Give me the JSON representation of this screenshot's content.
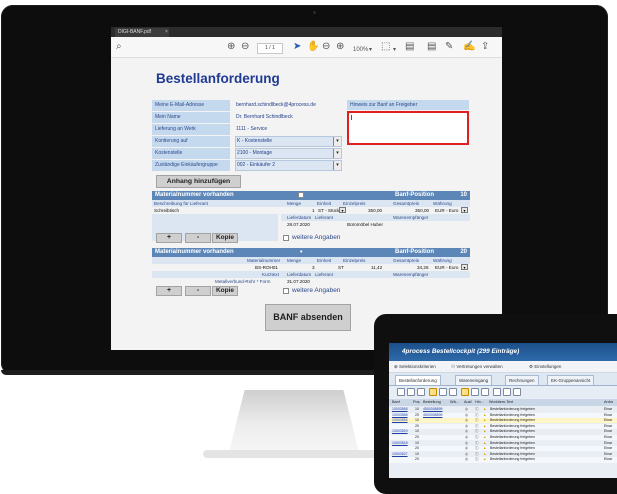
{
  "tab": {
    "title": "DIGI-BANF.pdf",
    "close": "×"
  },
  "toolbar": {
    "search_icon": "⌕",
    "up_icon": "⊕",
    "down_icon": "⊖",
    "page": "1",
    "page_total": "/ 1",
    "cursor_icon": "➤",
    "hand_icon": "✋",
    "zoom_out_icon": "⊖",
    "zoom_in_icon": "⊕",
    "zoom": "100%",
    "zoom_caret": "▾",
    "fit_icon": "⬚",
    "fit_caret": "▾",
    "comment_icon": "▤",
    "draw_icon": "✎",
    "sign_icon": "✍",
    "share_icon": "⇪"
  },
  "form": {
    "title": "Bestellanforderung",
    "fields": [
      {
        "label": "Meine E-Mail-Adresse",
        "value": "bernhard.schindlbeck@4process.de"
      },
      {
        "label": "Mein Name",
        "value": "Dr. Bernhard Schindlbeck"
      },
      {
        "label": "Lieferung an Werk",
        "value": "1111 - Service"
      },
      {
        "label": "Kontierung auf",
        "value": "K - Kostenstelle"
      },
      {
        "label": "Kostenstelle",
        "value": "2100 - Montage"
      },
      {
        "label": "Zuständige Einkäufergruppe",
        "value": "002 - Einkäufer 2"
      }
    ],
    "hint_label": "Hinweis zur Banf an Freigeber",
    "attach_button": "Anhang hinzufügen",
    "submit_button": "BANF absenden"
  },
  "position1": {
    "header_left": "Materialnummer vorhanden",
    "header_right": "Banf-Position",
    "number": "10",
    "cols": {
      "desc": "Beschreibung für Lieferant",
      "qty": "Menge",
      "unit": "Einheit",
      "price": "Einzelpreis",
      "total": "Gesamtpreis",
      "currency": "Währung"
    },
    "desc_value": "Schreibtisch",
    "qty": "1",
    "unit": "ST - Stück",
    "price": "350,00",
    "total": "350,00",
    "currency": "EUR - Euro",
    "delivery_label": "Lieferdatum",
    "supplier_label": "Lieferant",
    "recipient_label": "Warenempfänger",
    "delivery_date": "28.07.2020",
    "supplier": "Büromöbel Huber",
    "btn_plus": "+",
    "btn_minus": "-",
    "btn_copy": "Kopie",
    "more": "weitere Angaben"
  },
  "position2": {
    "header_left": "Materialnummer vorhanden",
    "header_right": "Banf-Position",
    "number": "20",
    "cols": {
      "mat": "Materialnummer",
      "qty": "Menge",
      "unit": "Einheit",
      "price": "Einzelpreis",
      "total": "Gesamtpreis",
      "currency": "Währung"
    },
    "material": "BS-ROH01",
    "qty": "3",
    "unit": "ST",
    "price": "11,42",
    "total": "34,26",
    "currency": "EUR - Euro",
    "short_label": "Kurztext",
    "delivery_label": "Lieferdatum",
    "supplier_label": "Lieferant",
    "recipient_label": "Warenempfänger",
    "short_text": "Metallverbund-Rohr * Form",
    "delivery_date": "31.07.2020",
    "btn_plus": "+",
    "btn_minus": "-",
    "btn_copy": "Kopie",
    "more": "weitere Angaben"
  },
  "cockpit": {
    "title": "4process Bestellcockpit (299 Einträge)",
    "toolbar": [
      "Selektionskriterien",
      "Vertretungen verwalten",
      "Einstellungen"
    ],
    "tabs": [
      "Bestellanforderung",
      "Wareneingang",
      "Rechnungen",
      "EK-Gruppenansicht"
    ],
    "headers": [
      "Banf",
      "Pos.",
      "Bestellung",
      "Wä...",
      "Ausf",
      "Hin...",
      "Workitem-Text",
      "Anfor"
    ],
    "rows": [
      {
        "banf": "10003558",
        "pos": "10",
        "order": "4500008899",
        "text": "Bestellanforderung freigeben",
        "req": "Einar"
      },
      {
        "banf": "10003558",
        "pos": "20",
        "order": "4500008899",
        "text": "Bestellanforderung freigeben",
        "req": "Einar"
      },
      {
        "banf": "10003554",
        "pos": "10",
        "order": "",
        "text": "Bestellanforderung freigeben",
        "req": "Einar"
      },
      {
        "banf": "",
        "pos": "20",
        "order": "",
        "text": "Bestellanforderung freigeben",
        "req": "Einar"
      },
      {
        "banf": "10003529",
        "pos": "10",
        "order": "",
        "text": "Bestellanforderung freigeben",
        "req": "Einar"
      },
      {
        "banf": "",
        "pos": "20",
        "order": "",
        "text": "Bestellanforderung freigeben",
        "req": "Einar"
      },
      {
        "banf": "10003518",
        "pos": "10",
        "order": "",
        "text": "Bestellanforderung freigeben",
        "req": "Einar"
      },
      {
        "banf": "",
        "pos": "20",
        "order": "",
        "text": "Bestellanforderung freigeben",
        "req": "Einar"
      },
      {
        "banf": "10003527",
        "pos": "10",
        "order": "",
        "text": "Bestellanforderung freigeben",
        "req": "Einar"
      },
      {
        "banf": "",
        "pos": "20",
        "order": "",
        "text": "Bestellanforderung freigeben",
        "req": "Einar"
      }
    ]
  }
}
